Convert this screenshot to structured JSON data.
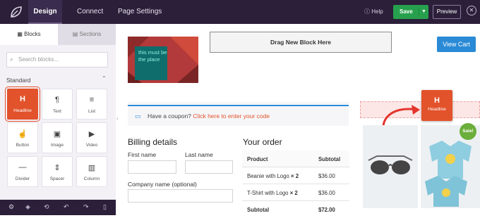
{
  "topbar": {
    "tabs": [
      {
        "label": "Design"
      },
      {
        "label": "Connect"
      },
      {
        "label": "Page Settings"
      }
    ],
    "help_label": "Help",
    "save_label": "Save",
    "preview_label": "Preview"
  },
  "sidebar": {
    "tabs": [
      {
        "label": "Blocks"
      },
      {
        "label": "Sections"
      }
    ],
    "search_placeholder": "Search blocks...",
    "group_label": "Standard",
    "blocks": [
      {
        "label": "Headline",
        "icon": "heading-icon",
        "glyph": "H"
      },
      {
        "label": "Text",
        "icon": "paragraph-icon",
        "glyph": "¶"
      },
      {
        "label": "List",
        "icon": "list-icon",
        "glyph": "≡"
      },
      {
        "label": "Button",
        "icon": "hand-pointer-icon",
        "glyph": "☝"
      },
      {
        "label": "Image",
        "icon": "image-icon",
        "glyph": "▣"
      },
      {
        "label": "Video",
        "icon": "video-icon",
        "glyph": "▶"
      },
      {
        "label": "Divider",
        "icon": "divider-icon",
        "glyph": "—"
      },
      {
        "label": "Spacer",
        "icon": "spacer-icon",
        "glyph": "⇕"
      },
      {
        "label": "Column",
        "icon": "columns-icon",
        "glyph": "▥"
      }
    ]
  },
  "canvas": {
    "image_text": "this must be the place",
    "dropzone_label": "Drag New Block Here",
    "view_cart_label": "View Cart",
    "coupon_text": "Have a coupon?",
    "coupon_link": "Click here to enter your code",
    "drag_block": {
      "label": "Headline",
      "glyph": "H"
    },
    "billing_title": "Billing details",
    "first_name_label": "First name",
    "last_name_label": "Last name",
    "company_label": "Company name (optional)",
    "order_title": "Your order",
    "order": {
      "headers": [
        "Product",
        "Subtotal"
      ],
      "rows": [
        {
          "product": "Beanie with Logo",
          "qty": "× 2",
          "subtotal": "$36.00"
        },
        {
          "product": "T-Shirt with Logo",
          "qty": "× 2",
          "subtotal": "$36.00"
        }
      ],
      "subtotal_label": "Subtotal",
      "subtotal_value": "$72.00"
    },
    "sale_badge": "Sale!"
  },
  "colors": {
    "topbar_bg": "#2b1f3a",
    "accent_orange": "#e2522b",
    "save_green": "#27a04d",
    "view_cart_blue": "#2a8ad6"
  }
}
